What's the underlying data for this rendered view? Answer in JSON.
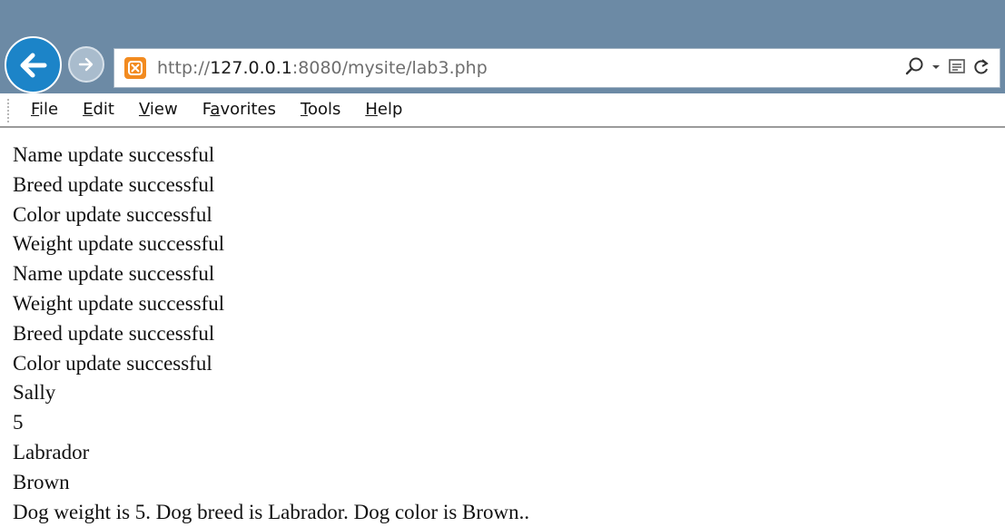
{
  "address_bar": {
    "url_scheme": "http://",
    "url_host": "127.0.0.1",
    "url_rest": ":8080/mysite/lab3.php"
  },
  "menu": {
    "items": [
      {
        "accel": "F",
        "rest": "ile"
      },
      {
        "accel": "E",
        "rest": "dit"
      },
      {
        "accel": "V",
        "rest": "iew"
      },
      {
        "pre": "F",
        "accel": "a",
        "rest": "vorites"
      },
      {
        "accel": "T",
        "rest": "ools"
      },
      {
        "accel": "H",
        "rest": "elp"
      }
    ]
  },
  "content": {
    "lines": [
      "Name update successful",
      "Breed update successful",
      "Color update successful",
      "Weight update successful",
      "Name update successful",
      "Weight update successful",
      "Breed update successful",
      "Color update successful",
      "Sally",
      "5",
      "Labrador",
      "Brown",
      "Dog weight is 5. Dog breed is Labrador. Dog color is Brown.."
    ]
  },
  "icons": {
    "back": "back-arrow-icon",
    "forward": "forward-arrow-icon",
    "favicon": "xampp-favicon-icon",
    "search": "search-icon",
    "dropdown": "chevron-down-icon",
    "compat": "compatibility-view-icon",
    "refresh": "refresh-icon"
  },
  "colors": {
    "titlebar": "#6c8aa5",
    "back_button": "#1c84c8",
    "favicon": "#f28b20"
  }
}
